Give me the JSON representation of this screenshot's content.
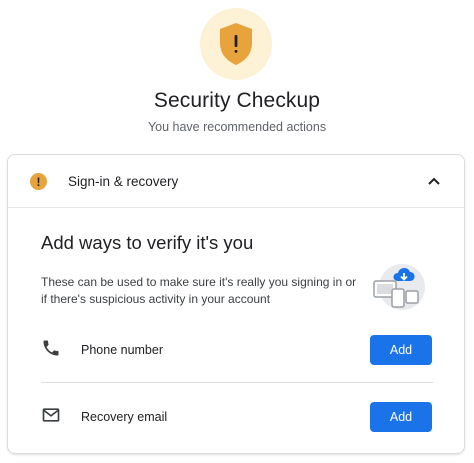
{
  "header": {
    "title": "Security Checkup",
    "subtitle": "You have recommended actions",
    "hero_icon": "shield-warning-icon"
  },
  "card": {
    "header_label": "Sign-in & recovery",
    "header_icon": "warning-icon",
    "collapse_icon": "chevron-up-icon",
    "warning_glyph": "!",
    "section_title": "Add ways to verify it's you",
    "section_description": "These can be used to make sure it's really you signing in or if there's suspicious activity in your account",
    "illustration_icon": "cloud-download-devices-icon",
    "rows": [
      {
        "icon": "phone-icon",
        "label": "Phone number",
        "button_label": "Add"
      },
      {
        "icon": "mail-icon",
        "label": "Recovery email",
        "button_label": "Add"
      }
    ]
  },
  "colors": {
    "primary": "#1a73e8",
    "warning": "#e8a33d",
    "hero_bg": "#fdf1d6",
    "text": "#202124",
    "muted": "#5f6368"
  }
}
